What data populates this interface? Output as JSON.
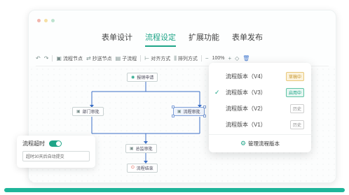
{
  "colors": {
    "accent": "#1fa588",
    "draft": "#c99a35",
    "bottom_bar": "#1fb59a"
  },
  "window_dots": [
    "#f2b6ad",
    "#f5dfa3",
    "#bde3cf"
  ],
  "tabs": [
    {
      "label": "表单设计",
      "active": false
    },
    {
      "label": "流程设定",
      "active": true
    },
    {
      "label": "扩展功能",
      "active": false
    },
    {
      "label": "表单发布",
      "active": false
    }
  ],
  "toolbar": {
    "undo_icon": "undo-icon",
    "redo_icon": "redo-icon",
    "process_node": "流程节点",
    "cc_node": "抄送节点",
    "sub_process": "子流程",
    "align": "对齐方式",
    "arrange": "排列方式",
    "zoom": "100%"
  },
  "flow": {
    "start": "报销申请",
    "left_branch": "部门审批",
    "right_branch": "流程审批",
    "finance": "总监审批",
    "end": "流程结束"
  },
  "timeout": {
    "label": "流程超时",
    "enabled": true,
    "input_value": "超时30天后自动提交"
  },
  "versions": {
    "items": [
      {
        "label": "流程版本（V4）",
        "status": "草稿中",
        "kind": "draft",
        "checked": false
      },
      {
        "label": "流程版本（V3）",
        "status": "启用中",
        "kind": "on",
        "checked": true
      },
      {
        "label": "流程版本（V2）",
        "status": "历史",
        "kind": "hist",
        "checked": false
      },
      {
        "label": "流程版本（V1）",
        "status": "历史",
        "kind": "hist",
        "checked": false
      }
    ],
    "manage_label": "管理流程版本"
  }
}
